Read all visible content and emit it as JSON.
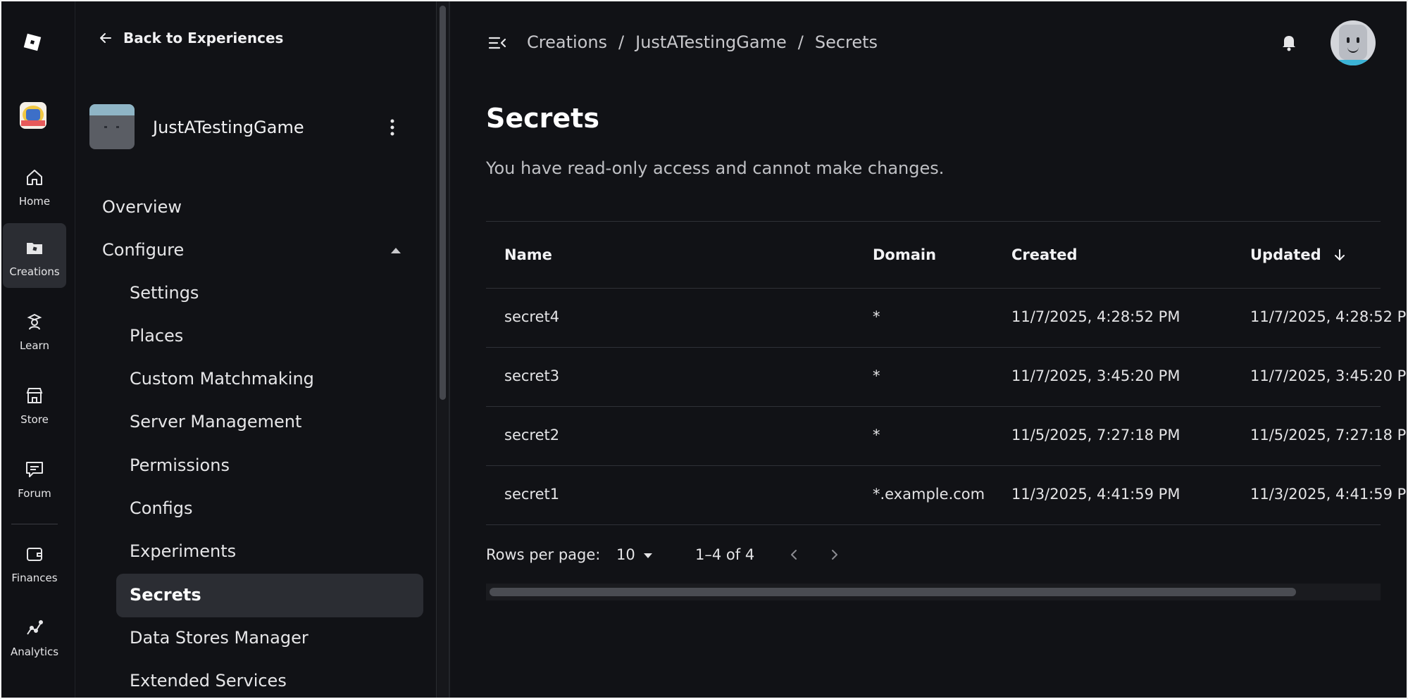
{
  "rail": {
    "items": [
      {
        "label": "Home",
        "icon": "home-icon"
      },
      {
        "label": "Creations",
        "icon": "folder-icon"
      },
      {
        "label": "Learn",
        "icon": "graduation-icon"
      },
      {
        "label": "Store",
        "icon": "store-icon"
      },
      {
        "label": "Forum",
        "icon": "forum-icon"
      },
      {
        "label": "Finances",
        "icon": "wallet-icon"
      },
      {
        "label": "Analytics",
        "icon": "analytics-icon"
      }
    ],
    "active": "Creations"
  },
  "sidenav": {
    "back_label": "Back to Experiences",
    "game_name": "JustATestingGame",
    "overview": "Overview",
    "configure": "Configure",
    "sub_items": [
      "Settings",
      "Places",
      "Custom Matchmaking",
      "Server Management",
      "Permissions",
      "Configs",
      "Experiments",
      "Secrets",
      "Data Stores Manager",
      "Extended Services"
    ],
    "active_item": "Secrets"
  },
  "breadcrumb": {
    "items": [
      "Creations",
      "JustATestingGame",
      "Secrets"
    ],
    "separator": "/"
  },
  "page": {
    "title": "Secrets",
    "subtitle": "You have read-only access and cannot make changes."
  },
  "table": {
    "columns": [
      "Name",
      "Domain",
      "Created",
      "Updated"
    ],
    "rows": [
      {
        "name": "secret4",
        "domain": "*",
        "created": "11/7/2025, 4:28:52 PM",
        "updated": "11/7/2025, 4:28:52 P"
      },
      {
        "name": "secret3",
        "domain": "*",
        "created": "11/7/2025, 3:45:20 PM",
        "updated": "11/7/2025, 3:45:20 P"
      },
      {
        "name": "secret2",
        "domain": "*",
        "created": "11/5/2025, 7:27:18 PM",
        "updated": "11/5/2025, 7:27:18 P"
      },
      {
        "name": "secret1",
        "domain": "*.example.com",
        "created": "11/3/2025, 4:41:59 PM",
        "updated": "11/3/2025, 4:41:59 P"
      }
    ]
  },
  "pagination": {
    "rows_per_page_label": "Rows per page:",
    "rows_per_page_value": "10",
    "range": "1–4 of 4"
  },
  "colors": {
    "background": "#111216",
    "active_bg": "#2b2d33",
    "text": "#e6e6e8"
  }
}
